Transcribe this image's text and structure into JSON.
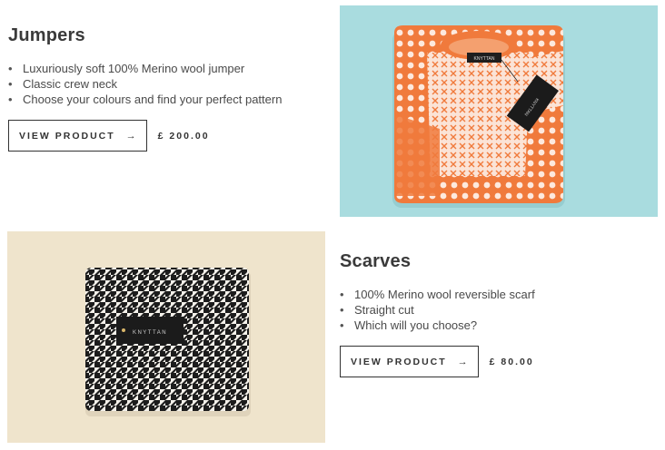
{
  "products": [
    {
      "title": "Jumpers",
      "features": [
        "Luxuriously soft 100% Merino wool jumper",
        "Classic crew neck",
        "Choose your colours and find your perfect pattern"
      ],
      "button_label": "VIEW PRODUCT",
      "button_arrow": "→",
      "price": "£ 200.00",
      "image_alt_tag": "KNYTTAN"
    },
    {
      "title": "Scarves",
      "features": [
        "100% Merino wool reversible scarf",
        "Straight cut",
        "Which will you choose?"
      ],
      "button_label": "VIEW PRODUCT",
      "button_arrow": "→",
      "price": "£ 80.00",
      "image_alt_tag": "KNYTTAN"
    }
  ],
  "colors": {
    "jumper_bg": "#a9dcdf",
    "jumper_orange": "#f07a3c",
    "scarf_bg": "#efe4cc"
  }
}
